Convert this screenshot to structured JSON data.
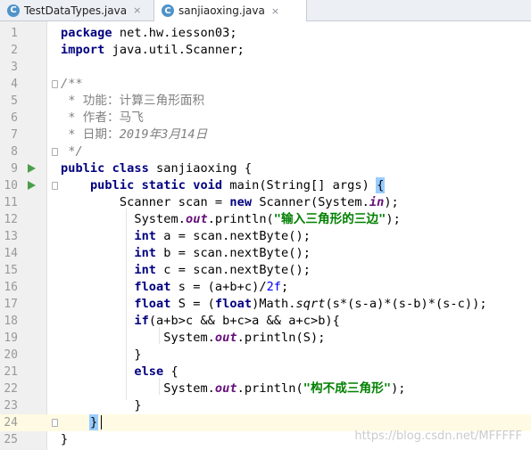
{
  "tabs": [
    {
      "label": "TestDataTypes.java",
      "icon": "java-class-icon",
      "active": false
    },
    {
      "label": "sanjiaoxing.java",
      "icon": "java-class-icon",
      "active": true
    }
  ],
  "tab_icon_letter": "C",
  "tab_close_glyph": "×",
  "current_line": 24,
  "lines": [
    [
      [
        "kw",
        "package"
      ],
      [
        "p",
        " net.hw.iesson03;"
      ]
    ],
    [
      [
        "kw",
        "import"
      ],
      [
        "p",
        " java.util.Scanner;"
      ]
    ],
    [],
    [
      [
        "cmt",
        "/**"
      ]
    ],
    [
      [
        "cmt",
        " * "
      ],
      [
        "cmtcn",
        "功能：计算三角形面积"
      ]
    ],
    [
      [
        "cmt",
        " * "
      ],
      [
        "cmtcn",
        "作者：马飞"
      ]
    ],
    [
      [
        "cmt",
        " * "
      ],
      [
        "cmtcn",
        "日期："
      ],
      [
        "cmt",
        "2019年3月14日"
      ]
    ],
    [
      [
        "cmt",
        " */"
      ]
    ],
    [
      [
        "kw",
        "public"
      ],
      [
        "p",
        " "
      ],
      [
        "kw",
        "class"
      ],
      [
        "p",
        " sanjiaoxing {"
      ]
    ],
    [
      [
        "p",
        "    "
      ],
      [
        "kw",
        "public"
      ],
      [
        "p",
        " "
      ],
      [
        "kw",
        "static"
      ],
      [
        "p",
        " "
      ],
      [
        "kw",
        "void"
      ],
      [
        "p",
        " main(String[] args) "
      ],
      [
        "brace",
        "{"
      ]
    ],
    [
      [
        "p",
        "        Scanner scan = "
      ],
      [
        "kw",
        "new"
      ],
      [
        "p",
        " Scanner(System."
      ],
      [
        "fld",
        "in"
      ],
      [
        "p",
        ");"
      ]
    ],
    [
      [
        "p",
        "          System."
      ],
      [
        "fld",
        "out"
      ],
      [
        "p",
        ".println("
      ],
      [
        "str",
        "\"输入三角形的三边\""
      ],
      [
        "p",
        ");"
      ]
    ],
    [
      [
        "p",
        "          "
      ],
      [
        "kw",
        "int"
      ],
      [
        "p",
        " a = scan.nextByte();"
      ]
    ],
    [
      [
        "p",
        "          "
      ],
      [
        "kw",
        "int"
      ],
      [
        "p",
        " b = scan.nextByte();"
      ]
    ],
    [
      [
        "p",
        "          "
      ],
      [
        "kw",
        "int"
      ],
      [
        "p",
        " c = scan.nextByte();"
      ]
    ],
    [
      [
        "p",
        "          "
      ],
      [
        "kw",
        "float"
      ],
      [
        "p",
        " s = (a+b+c)/"
      ],
      [
        "num",
        "2f"
      ],
      [
        "p",
        ";"
      ]
    ],
    [
      [
        "p",
        "          "
      ],
      [
        "kw",
        "float"
      ],
      [
        "p",
        " S = ("
      ],
      [
        "kw",
        "float"
      ],
      [
        "p",
        ")Math."
      ],
      [
        "stat",
        "sqrt"
      ],
      [
        "p",
        "(s*(s-a)*(s-b)*(s-c));"
      ]
    ],
    [
      [
        "p",
        "          "
      ],
      [
        "kw",
        "if"
      ],
      [
        "p",
        "(a+b>c && b+c>a && a+c>b){"
      ]
    ],
    [
      [
        "p",
        "              System."
      ],
      [
        "fld",
        "out"
      ],
      [
        "p",
        ".println(S);"
      ]
    ],
    [
      [
        "p",
        "          }"
      ]
    ],
    [
      [
        "p",
        "          "
      ],
      [
        "kw",
        "else"
      ],
      [
        "p",
        " {"
      ]
    ],
    [
      [
        "p",
        "              System."
      ],
      [
        "fld",
        "out"
      ],
      [
        "p",
        ".println("
      ],
      [
        "str",
        "\"构不成三角形\""
      ],
      [
        "p",
        ");"
      ]
    ],
    [
      [
        "p",
        "          }"
      ]
    ],
    [
      [
        "p",
        "    "
      ],
      [
        "brace",
        "}"
      ]
    ],
    [
      [
        "p",
        "}"
      ]
    ]
  ],
  "run_gutter_lines": [
    9,
    10
  ],
  "fold_markers": [
    4,
    8,
    10,
    24
  ],
  "watermark": "https://blog.csdn.net/MFFFFF",
  "colors": {
    "keyword": "#000080",
    "comment": "#808080",
    "string": "#008000",
    "number": "#0000ff",
    "field": "#660e7a",
    "current_line": "#fffae3",
    "brace_match": "#99ccff",
    "run_icon": "#4a9f4a"
  }
}
